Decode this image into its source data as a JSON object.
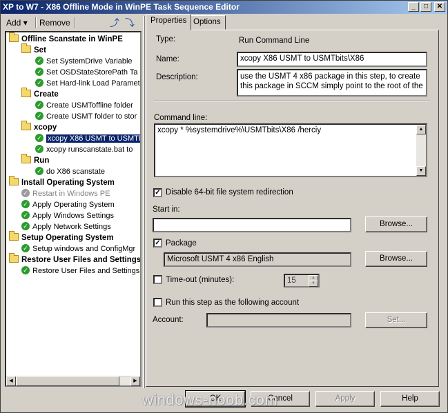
{
  "window": {
    "title": "XP to W7 - X86 Offline Mode in WinPE Task Sequence Editor",
    "minimize_glyph": "_",
    "maximize_glyph": "□",
    "close_glyph": "✕"
  },
  "toolbar": {
    "add_label": "Add",
    "remove_label": "Remove",
    "icons": [
      "move-up-icon",
      "move-down-icon"
    ]
  },
  "tree": [
    {
      "label": "Offline Scanstate in WinPE",
      "type": "group",
      "icon": "folder-icon"
    },
    {
      "label": "Set",
      "type": "group",
      "icon": "folder-icon"
    },
    {
      "label": "Set SystemDrive Variable",
      "type": "step",
      "icon": "check-icon"
    },
    {
      "label": "Set OSDStateStorePath Ta",
      "type": "step",
      "icon": "check-icon"
    },
    {
      "label": "Set Hard-link Load Paramet",
      "type": "step",
      "icon": "check-icon"
    },
    {
      "label": "Create",
      "type": "group",
      "icon": "folder-icon"
    },
    {
      "label": "Create USMToffline folder",
      "type": "step",
      "icon": "check-icon"
    },
    {
      "label": "Create USMT folder to stor",
      "type": "step",
      "icon": "check-icon"
    },
    {
      "label": "xcopy",
      "type": "group",
      "icon": "folder-icon"
    },
    {
      "label": "xcopy X86 USMT to USMTb",
      "type": "step",
      "icon": "check-icon",
      "selected": true
    },
    {
      "label": "xcopy runscanstate.bat to",
      "type": "step",
      "icon": "check-icon"
    },
    {
      "label": "Run",
      "type": "group",
      "icon": "folder-icon"
    },
    {
      "label": "do X86 scanstate",
      "type": "step",
      "icon": "check-icon"
    },
    {
      "label": "Install Operating System",
      "type": "group",
      "icon": "folder-icon"
    },
    {
      "label": "Restart in Windows PE",
      "type": "step",
      "icon": "check-icon",
      "disabled": true
    },
    {
      "label": "Apply Operating System",
      "type": "step",
      "icon": "check-icon"
    },
    {
      "label": "Apply Windows Settings",
      "type": "step",
      "icon": "check-icon"
    },
    {
      "label": "Apply Network Settings",
      "type": "step",
      "icon": "check-icon"
    },
    {
      "label": "Setup Operating System",
      "type": "group",
      "icon": "folder-icon"
    },
    {
      "label": "Setup windows and ConfigMgr",
      "type": "step",
      "icon": "check-icon"
    },
    {
      "label": "Restore User Files and Settings",
      "type": "group",
      "icon": "folder-icon"
    },
    {
      "label": "Restore User Files and Settings",
      "type": "step",
      "icon": "check-icon"
    }
  ],
  "tabs": [
    {
      "label": "Properties",
      "active": true
    },
    {
      "label": "Options",
      "active": false
    }
  ],
  "properties": {
    "type_label": "Type:",
    "type_value": "Run Command Line",
    "name_label": "Name:",
    "name_value": "xcopy X86 USMT to USMTbits\\X86",
    "description_label": "Description:",
    "description_value": "use the USMT 4  x86 package in this step, to create this package in SCCM simply point to the root of the",
    "command_line_label": "Command line:",
    "command_line_value": "xcopy * %systemdrive%\\USMTbits\\X86 /herciy",
    "disable_redirection_label": "Disable 64-bit file system redirection",
    "disable_redirection_checked": true,
    "start_in_label": "Start in:",
    "start_in_value": "",
    "browse_label": "Browse...",
    "package_label": "Package",
    "package_checked": true,
    "package_value": "Microsoft USMT 4 x86 English",
    "package_browse_label": "Browse...",
    "timeout_label": "Time-out (minutes):",
    "timeout_checked": false,
    "timeout_value": "15",
    "run_as_label": "Run this step as the following account",
    "run_as_checked": false,
    "account_label": "Account:",
    "account_value": "",
    "set_label": "Set..."
  },
  "footer": {
    "ok_label": "OK",
    "cancel_label": "Cancel",
    "apply_label": "Apply",
    "help_label": "Help"
  },
  "watermark": "windows-noob.com"
}
